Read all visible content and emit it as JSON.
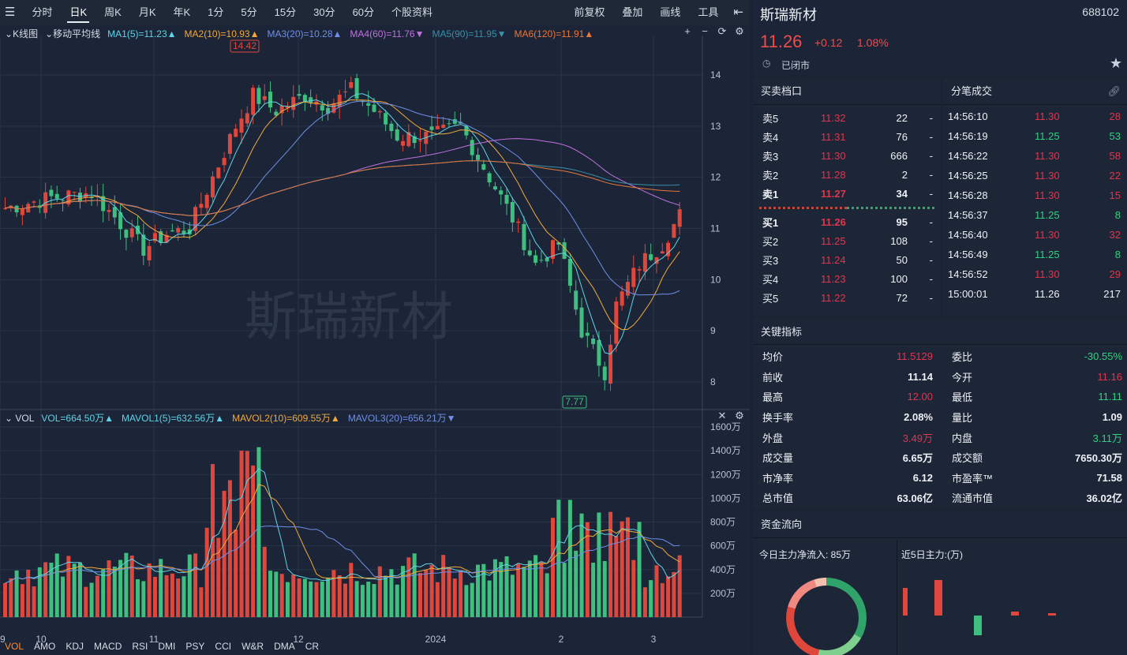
{
  "toolbar": {
    "items": [
      "分时",
      "日K",
      "周K",
      "月K",
      "年K",
      "1分",
      "5分",
      "15分",
      "30分",
      "60分",
      "个股资料"
    ],
    "active": "日K",
    "right": [
      "前复权",
      "叠加",
      "画线",
      "工具"
    ]
  },
  "kline": {
    "title": "K线图",
    "ma_title": "移动平均线",
    "ma": [
      {
        "label": "MA1(5)=11.23",
        "arrow": "▲",
        "color": "#5fd4e6"
      },
      {
        "label": "MA2(10)=10.93",
        "arrow": "▲",
        "color": "#f2a93b"
      },
      {
        "label": "MA3(20)=10.28",
        "arrow": "▲",
        "color": "#6f8fe8"
      },
      {
        "label": "MA4(60)=11.76",
        "arrow": "▼",
        "color": "#c170e0"
      },
      {
        "label": "MA5(90)=11.95",
        "arrow": "▼",
        "color": "#3b8fa8"
      },
      {
        "label": "MA6(120)=11.91",
        "arrow": "▲",
        "color": "#e8773b"
      }
    ],
    "high_label": "14.42",
    "low_label": "7.77",
    "watermark": "斯瑞新材",
    "y_ticks": [
      "14",
      "13",
      "12",
      "11",
      "10",
      "9",
      "8"
    ]
  },
  "volume": {
    "title": "VOL",
    "legend": [
      {
        "label": "VOL=664.50万",
        "arrow": "▲",
        "color": "#5fd4e6"
      },
      {
        "label": "MAVOL1(5)=632.56万",
        "arrow": "▲",
        "color": "#5fd4e6"
      },
      {
        "label": "MAVOL2(10)=609.55万",
        "arrow": "▲",
        "color": "#f2a93b"
      },
      {
        "label": "MAVOL3(20)=656.21万",
        "arrow": "▼",
        "color": "#6f8fe8"
      }
    ],
    "y_ticks": [
      "1600万",
      "1400万",
      "1200万",
      "1000万",
      "800万",
      "600万",
      "400万",
      "200万"
    ]
  },
  "x_axis": [
    "9",
    "10",
    "11",
    "12",
    "2024",
    "2",
    "3"
  ],
  "indicator_tabs": [
    "VOL",
    "AMO",
    "KDJ",
    "MACD",
    "RSI",
    "DMI",
    "PSY",
    "CCI",
    "W&R",
    "DMA",
    "CR"
  ],
  "stock": {
    "name": "斯瑞新材",
    "code": "688102",
    "price": "11.26",
    "change": "+0.12",
    "change_pct": "1.08%",
    "status": "已闭市"
  },
  "orderbook": {
    "title": "买卖档口",
    "asks": [
      {
        "label": "卖5",
        "price": "11.32",
        "vol": "22",
        "flag": "-"
      },
      {
        "label": "卖4",
        "price": "11.31",
        "vol": "76",
        "flag": "-"
      },
      {
        "label": "卖3",
        "price": "11.30",
        "vol": "666",
        "flag": "-"
      },
      {
        "label": "卖2",
        "price": "11.28",
        "vol": "2",
        "flag": "-"
      },
      {
        "label": "卖1",
        "price": "11.27",
        "vol": "34",
        "flag": "-"
      }
    ],
    "bids": [
      {
        "label": "买1",
        "price": "11.26",
        "vol": "95",
        "flag": "-"
      },
      {
        "label": "买2",
        "price": "11.25",
        "vol": "108",
        "flag": "-"
      },
      {
        "label": "买3",
        "price": "11.24",
        "vol": "50",
        "flag": "-"
      },
      {
        "label": "买4",
        "price": "11.23",
        "vol": "100",
        "flag": "-"
      },
      {
        "label": "买5",
        "price": "11.22",
        "vol": "72",
        "flag": "-"
      }
    ]
  },
  "trades": {
    "title": "分笔成交",
    "rows": [
      {
        "time": "14:56:10",
        "price": "11.30",
        "vol": "28",
        "color": "red"
      },
      {
        "time": "14:56:19",
        "price": "11.25",
        "vol": "53",
        "color": "green"
      },
      {
        "time": "14:56:22",
        "price": "11.30",
        "vol": "58",
        "color": "red"
      },
      {
        "time": "14:56:25",
        "price": "11.30",
        "vol": "22",
        "color": "red"
      },
      {
        "time": "14:56:28",
        "price": "11.30",
        "vol": "15",
        "color": "red"
      },
      {
        "time": "14:56:37",
        "price": "11.25",
        "vol": "8",
        "color": "green"
      },
      {
        "time": "14:56:40",
        "price": "11.30",
        "vol": "32",
        "color": "red"
      },
      {
        "time": "14:56:49",
        "price": "11.25",
        "vol": "8",
        "color": "green"
      },
      {
        "time": "14:56:52",
        "price": "11.30",
        "vol": "29",
        "color": "red"
      },
      {
        "time": "15:00:01",
        "price": "11.26",
        "vol": "217",
        "color": "white"
      }
    ]
  },
  "key_metrics": {
    "title": "关键指标",
    "rows": [
      [
        {
          "label": "均价",
          "value": "11.5129",
          "color": "red"
        },
        {
          "label": "委比",
          "value": "-30.55%",
          "color": "green"
        }
      ],
      [
        {
          "label": "前收",
          "value": "11.14",
          "color": "white"
        },
        {
          "label": "今开",
          "value": "11.16",
          "color": "red"
        }
      ],
      [
        {
          "label": "最高",
          "value": "12.00",
          "color": "red"
        },
        {
          "label": "最低",
          "value": "11.11",
          "color": "green"
        }
      ],
      [
        {
          "label": "换手率",
          "value": "2.08%",
          "color": "white"
        },
        {
          "label": "量比",
          "value": "1.09",
          "color": "white"
        }
      ],
      [
        {
          "label": "外盘",
          "value": "3.49万",
          "color": "red"
        },
        {
          "label": "内盘",
          "value": "3.11万",
          "color": "green"
        }
      ],
      [
        {
          "label": "成交量",
          "value": "6.65万",
          "color": "white"
        },
        {
          "label": "成交额",
          "value": "7650.30万",
          "color": "white"
        }
      ],
      [
        {
          "label": "市净率",
          "value": "6.12",
          "color": "white"
        },
        {
          "label": "市盈率™",
          "value": "71.58",
          "color": "white"
        }
      ],
      [
        {
          "label": "总市值",
          "value": "63.06亿",
          "color": "white"
        },
        {
          "label": "流通市值",
          "value": "36.02亿",
          "color": "white"
        }
      ]
    ]
  },
  "fund_flow": {
    "title": "资金流向",
    "today_label": "今日主力净流入: 85万",
    "five_day_label": "近5日主力:(万)",
    "five_day_values": [
      28,
      45,
      -25,
      5,
      3
    ]
  },
  "colors": {
    "up": "#e0473c",
    "down": "#3fbf7f",
    "flat": "#b8bfc8"
  }
}
